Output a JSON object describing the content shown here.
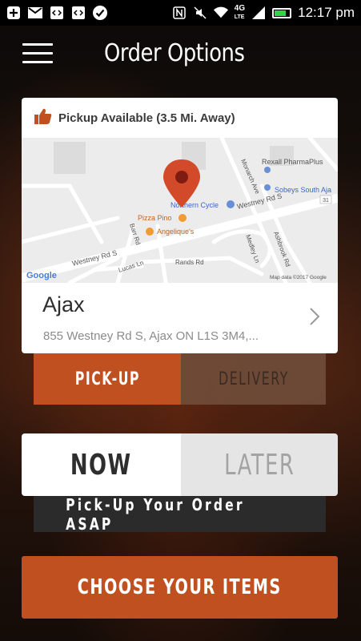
{
  "status_bar": {
    "time": "12:17 pm",
    "network": "4G",
    "network_sub": "LTE",
    "icons": [
      "add-icon",
      "gmail-icon",
      "code-icon",
      "code-icon",
      "check-icon",
      "nfc-icon",
      "mute-icon",
      "wifi-icon",
      "signal-icon",
      "battery-icon"
    ]
  },
  "header": {
    "title": "Order Options",
    "menu_icon": "hamburger-menu-icon"
  },
  "location_card": {
    "availability": "Pickup Available (3.5 Mi. Away)",
    "availability_icon": "thumbs-up-icon",
    "store_name": "Ajax",
    "store_address": "855 Westney Rd S, Ajax ON L1S 3M4,...",
    "map": {
      "labels": {
        "rexall": "Rexall PharmaPlus",
        "sobeys": "Sobeys South Aja",
        "northern_cycle": "Northern Cycle",
        "pizza_pino": "Pizza Pino",
        "angeliques": "Angelique's",
        "westney_rd_s_top": "Westney Rd S",
        "westney_rd_s_bottom": "Westney Rd S",
        "monarch_ave": "Monarch Ave",
        "barr_rd": "Barr Rd",
        "medley_ln": "Medley Ln",
        "rands_rd": "Rands Rd",
        "lucas_ln": "Lucas Ln",
        "ashbrook_rd": "Ashbrook Rd",
        "route": "31",
        "google": "Google",
        "attribution": "Map data ©2017 Google"
      }
    }
  },
  "order_method": {
    "pickup_label": "PICK-UP",
    "delivery_label": "DELIVERY",
    "selected": "PICK-UP"
  },
  "order_timing": {
    "now_label": "NOW",
    "later_label": "LATER",
    "selected": "NOW"
  },
  "asap_message": "Pick-Up Your Order ASAP",
  "cta_label": "CHOOSE YOUR ITEMS",
  "colors": {
    "accent": "#c0501f",
    "map_pin": "#d34a2a"
  }
}
